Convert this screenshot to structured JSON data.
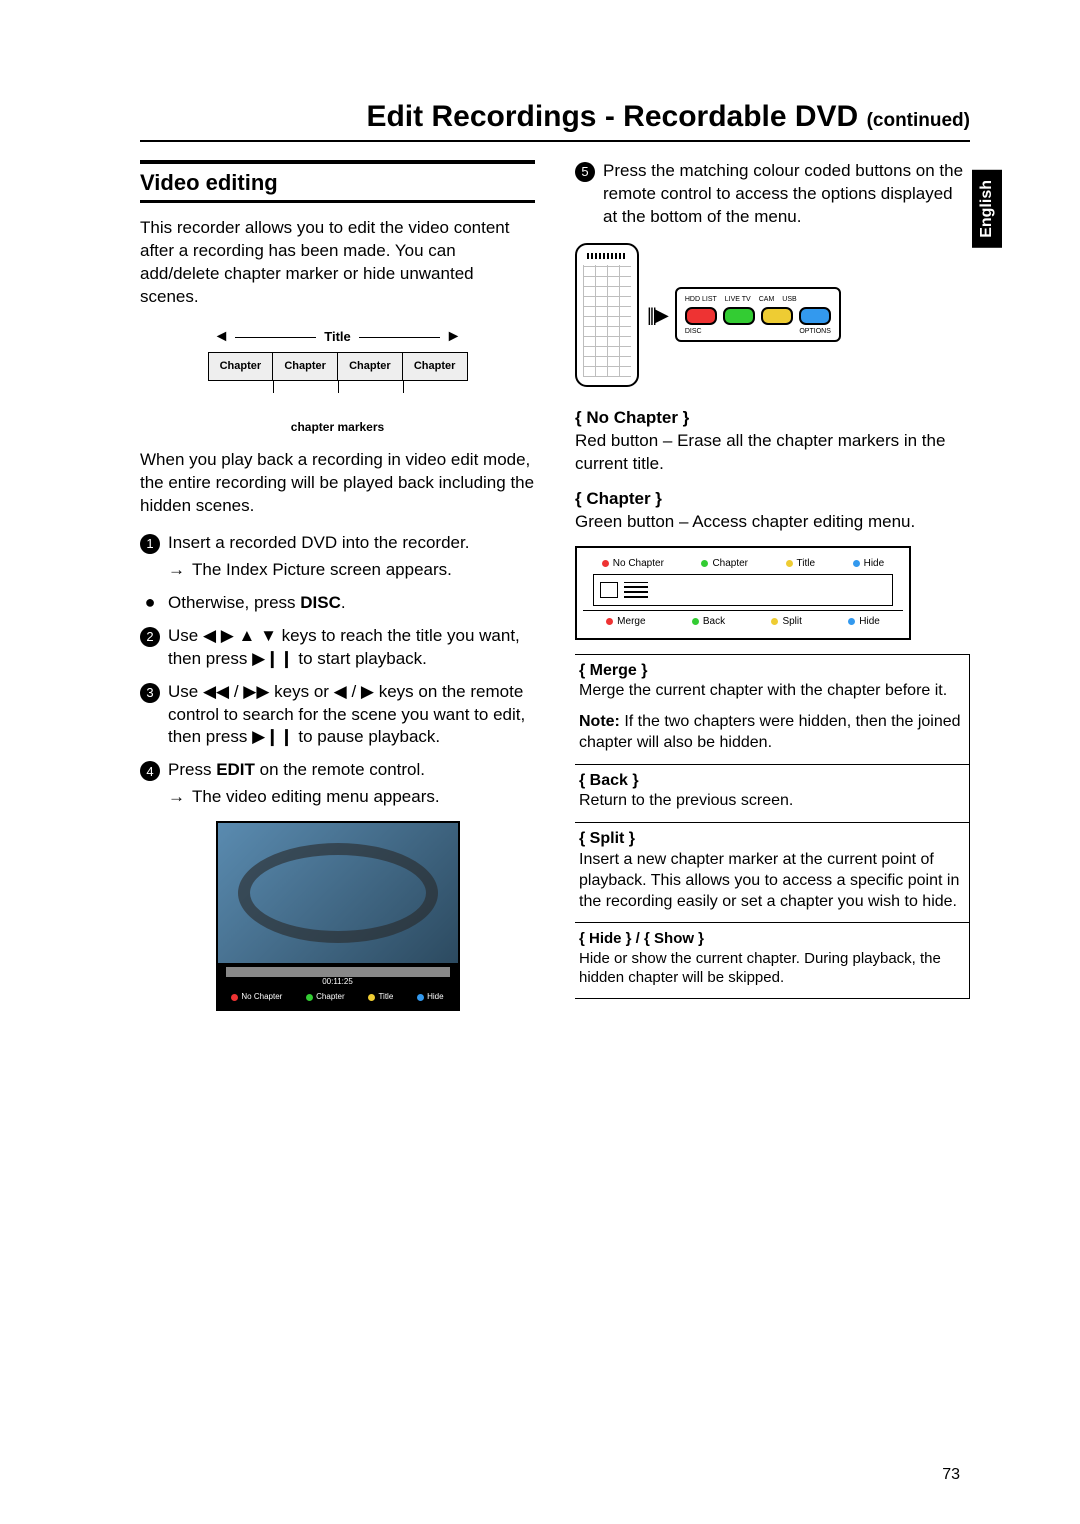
{
  "page_number": "73",
  "side_tab": "English",
  "page_title_main": "Edit Recordings - Recordable DVD",
  "page_title_cont": "(continued)",
  "section_heading": "Video editing",
  "intro_para": "This recorder allows you to edit the video content after a recording has been made. You can add/delete chapter marker or hide unwanted scenes.",
  "title_diagram": {
    "title_label": "Title",
    "chapter_label": "Chapter",
    "markers_note": "chapter markers"
  },
  "playback_para": "When you play back a recording in video edit mode, the entire recording will be played back including the hidden scenes.",
  "steps": {
    "s1": "Insert a recorded DVD into the recorder.",
    "s1_sub": "The Index Picture screen appears.",
    "bullet": "Otherwise, press ",
    "bullet_bold": "DISC",
    "s2": "Use ◀ ▶ ▲ ▼ keys to reach the title you want, then press ▶❙❙ to start playback.",
    "s3": "Use ◀◀ / ▶▶ keys or ◀ / ▶ keys on the remote control to search for the scene you want to edit, then press ▶❙❙ to pause playback.",
    "s4_a": "Press ",
    "s4_b": "EDIT",
    "s4_c": " on the remote control.",
    "s4_sub": "The video editing menu appears.",
    "s5": "Press the matching colour coded buttons on the remote control to access the options displayed at the bottom of the menu."
  },
  "screenshot": {
    "timecode": "00:11:25",
    "opt1": "No Chapter",
    "opt2": "Chapter",
    "opt3": "Title",
    "opt4": "Hide"
  },
  "remote_zoom": {
    "labels": [
      "HDD LIST",
      "LIVE TV",
      "CAM",
      "USB"
    ],
    "sub_left": "DISC",
    "sub_right": "OPTIONS"
  },
  "right_options": {
    "no_chapter_term": "{ No Chapter }",
    "no_chapter_desc": "Red button – Erase all the chapter markers in the current title.",
    "chapter_term": "{ Chapter }",
    "chapter_desc": "Green button – Access chapter editing menu."
  },
  "chapter_menu": {
    "top": [
      "No Chapter",
      "Chapter",
      "Title",
      "Hide"
    ],
    "bottom": [
      "Merge",
      "Back",
      "Split",
      "Hide"
    ]
  },
  "options_table": {
    "merge_term": "{ Merge }",
    "merge_desc": "Merge the current chapter with the chapter before it.",
    "merge_note_bold": "Note:",
    "merge_note": " If the two chapters were hidden, then the joined chapter will also be hidden.",
    "back_term": "{ Back }",
    "back_desc": "Return to the previous screen.",
    "split_term": "{ Split }",
    "split_desc": "Insert a new chapter marker at the current point of playback. This allows you to access a specific point in the recording easily or set a chapter you wish to hide.",
    "hide_term": "{ Hide } / { Show }",
    "hide_desc": "Hide or show the current chapter. During playback, the hidden chapter will be skipped."
  }
}
